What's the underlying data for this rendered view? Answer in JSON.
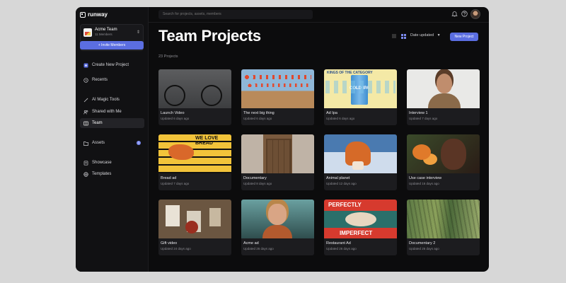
{
  "app": {
    "logo_text": "runway"
  },
  "sidebar": {
    "team": {
      "name": "Acme Team",
      "members": "11 Members"
    },
    "invite_label": "+ Invite Members",
    "items": [
      {
        "label": "Create New Project",
        "icon": "plus-square-icon"
      },
      {
        "label": "Recents",
        "icon": "clock-icon"
      },
      {
        "label": "AI Magic Tools",
        "icon": "magic-wand-icon"
      },
      {
        "label": "Shared with Me",
        "icon": "shared-icon"
      },
      {
        "label": "Team",
        "icon": "team-icon",
        "active": true
      },
      {
        "label": "Assets",
        "icon": "folder-icon",
        "badge": "1"
      },
      {
        "label": "Showcase",
        "icon": "showcase-icon"
      },
      {
        "label": "Templates",
        "icon": "globe-icon"
      }
    ]
  },
  "topbar": {
    "search_placeholder": "Search for projects, assets, members"
  },
  "main": {
    "title": "Team Projects",
    "count": "23 Projects",
    "sort_label": "Date updated",
    "new_project_label": "New Project",
    "projects": [
      {
        "title": "Launch Video",
        "updated": "Updated 6 days ago",
        "thumb": "t-bike"
      },
      {
        "title": "The next big thing",
        "updated": "Updated 6 days ago",
        "thumb": "t-lanterns"
      },
      {
        "title": "Ad Ipa",
        "updated": "Updated 6 days ago",
        "thumb": "t-ipa"
      },
      {
        "title": "Interview 1",
        "updated": "Updated 7 days ago",
        "thumb": "t-portrait"
      },
      {
        "title": "Bread ad",
        "updated": "Updated 7 days ago",
        "thumb": "t-bread"
      },
      {
        "title": "Documentary",
        "updated": "Updated 8 days ago",
        "thumb": "t-door"
      },
      {
        "title": "Animal planet",
        "updated": "Updated 12 days ago",
        "thumb": "t-fox"
      },
      {
        "title": "Use case interview",
        "updated": "Updated 16 days ago",
        "thumb": "t-flowers"
      },
      {
        "title": "Gift video",
        "updated": "Updated 24 days ago",
        "thumb": "t-gift"
      },
      {
        "title": "Acme ad",
        "updated": "Updated 26 days ago",
        "thumb": "t-woman"
      },
      {
        "title": "Restaurant Ad",
        "updated": "Updated 26 days ago",
        "thumb": "t-perfect"
      },
      {
        "title": "Documentary 2",
        "updated": "Updated 26 days ago",
        "thumb": "t-aerial"
      }
    ],
    "thumb_text": {
      "ipa_top": "KINGS OF THE CATEGORY",
      "ipa_main": "COLD IPA",
      "bread": "WE LOVE BREAD",
      "perfect_top": "PERFECTLY",
      "perfect_bottom": "IMPERFECT"
    }
  },
  "colors": {
    "accent": "#5b6ee1",
    "bg": "#0c0c0d",
    "sidebar": "#111113",
    "card": "#1c1c1f"
  }
}
